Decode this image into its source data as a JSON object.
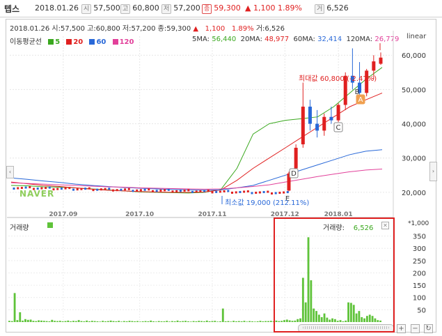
{
  "header": {
    "stock_name": "텝스",
    "date": "2018.01.26",
    "open_label": "시",
    "open": "57,500",
    "high_label": "고",
    "high": "60,800",
    "low_label": "저",
    "low": "57,200",
    "close_label": "종",
    "close": "59,300",
    "change_arrow": "▲",
    "change": "1,100",
    "change_pct": "1.89%",
    "volume_label": "거",
    "volume": "6,526"
  },
  "chart_info": {
    "line": "2018.01.26 시:57,500 고:60,800 저:57,200 종:59,300",
    "change_arrow": "▲",
    "change": "1,100",
    "change_pct": "1.89%",
    "volume": "거:6,526"
  },
  "ma_legend": {
    "title": "이동평균선",
    "items": [
      {
        "label": "5",
        "color": "#3aa81e"
      },
      {
        "label": "20",
        "color": "#e02020"
      },
      {
        "label": "60",
        "color": "#2868d8"
      },
      {
        "label": "120",
        "color": "#e2409a"
      }
    ]
  },
  "ma_values": {
    "ma5_label": "5MA:",
    "ma5": "56,440",
    "ma20_label": "20MA:",
    "ma20": "48,977",
    "ma60_label": "60MA:",
    "ma60": "32,414",
    "ma120_label": "120MA:",
    "ma120": "26,779"
  },
  "scale_mode": "linear",
  "watermark": "NAVER",
  "annotations": {
    "max": "최대값 60,800 (-2.47%)",
    "min": "최소값 19,000 (212.11%)",
    "markers": [
      "A",
      "B",
      "C",
      "D",
      "E"
    ]
  },
  "volume_panel": {
    "title": "거래량",
    "legend_label": "거래량:",
    "legend_value": "6,526",
    "unit": "*1,000",
    "close": "✕"
  },
  "colors": {
    "up": "#e02020",
    "down": "#2868d8",
    "volume": "#5fc33a",
    "highlight": "#e02020"
  },
  "controls": {
    "zoom_in": "+",
    "zoom_out": "−",
    "reset": "↻",
    "left": "‹",
    "right": "›"
  },
  "chart_data": [
    {
      "type": "line",
      "title": "",
      "x_ticks": [
        "2017.09",
        "2017.10",
        "2017.11",
        "2017.12",
        "2018.01"
      ],
      "y_ticks": [
        20000,
        30000,
        40000,
        50000,
        60000
      ],
      "ylim": [
        15500,
        63500
      ],
      "grid": true,
      "series": [
        {
          "name": "5",
          "color": "#3aa81e",
          "values": [
            22000,
            21900,
            21600,
            21500,
            21300,
            21000,
            20700,
            20400,
            20100,
            20000,
            19900,
            19800,
            20000,
            20800,
            27000,
            37000,
            40000,
            41000,
            41500,
            42000,
            45000,
            49000,
            53000,
            56440
          ]
        },
        {
          "name": "20",
          "color": "#e02020",
          "values": [
            23000,
            22500,
            22000,
            21700,
            21300,
            20900,
            20600,
            20400,
            20200,
            20100,
            20000,
            20000,
            20100,
            20700,
            23500,
            27000,
            30000,
            33000,
            36000,
            39000,
            42000,
            45000,
            47000,
            48977
          ]
        },
        {
          "name": "60",
          "color": "#2868d8",
          "values": [
            24200,
            23800,
            23300,
            22900,
            22400,
            22000,
            21700,
            21400,
            21200,
            21000,
            20800,
            20700,
            20600,
            20700,
            21300,
            22000,
            23500,
            25000,
            26500,
            28000,
            29500,
            31000,
            32000,
            32414
          ]
        },
        {
          "name": "120",
          "color": "#e2409a",
          "values": [
            22800,
            22600,
            22400,
            22200,
            22000,
            21800,
            21600,
            21500,
            21300,
            21200,
            21100,
            21000,
            20900,
            21000,
            21300,
            21700,
            22200,
            23000,
            23800,
            24600,
            25300,
            26000,
            26500,
            26779
          ]
        }
      ],
      "candles_recent": [
        {
          "open": 20500,
          "high": 26000,
          "low": 20300,
          "close": 25500
        },
        {
          "open": 27000,
          "high": 34000,
          "low": 26000,
          "close": 33000
        },
        {
          "open": 34000,
          "high": 52000,
          "low": 33000,
          "close": 45000
        },
        {
          "open": 45000,
          "high": 47000,
          "low": 38000,
          "close": 40000
        },
        {
          "open": 40000,
          "high": 44000,
          "low": 36000,
          "close": 38000
        },
        {
          "open": 38000,
          "high": 43000,
          "low": 36500,
          "close": 42000
        },
        {
          "open": 42000,
          "high": 45000,
          "low": 40000,
          "close": 41000
        },
        {
          "open": 41000,
          "high": 46000,
          "low": 40500,
          "close": 45500
        },
        {
          "open": 45500,
          "high": 55000,
          "low": 44000,
          "close": 54000
        },
        {
          "open": 54000,
          "high": 62000,
          "low": 50000,
          "close": 52000
        },
        {
          "open": 52000,
          "high": 58000,
          "low": 47000,
          "close": 49000
        },
        {
          "open": 49000,
          "high": 56000,
          "low": 48000,
          "close": 55500
        },
        {
          "open": 55500,
          "high": 60000,
          "low": 53000,
          "close": 58200
        },
        {
          "open": 57500,
          "high": 60800,
          "low": 57200,
          "close": 59300
        }
      ]
    },
    {
      "type": "bar",
      "title": "",
      "unit": "*1,000",
      "y_ticks": [
        50,
        100,
        150,
        200,
        250,
        300,
        350
      ],
      "ylim": [
        0,
        380
      ],
      "values": [
        5,
        4,
        118,
        8,
        40,
        6,
        12,
        9,
        10,
        5,
        4,
        7,
        6,
        5,
        4,
        3,
        9,
        5,
        4,
        5,
        3,
        4,
        6,
        3,
        5,
        4,
        8,
        4,
        3,
        6,
        3,
        5,
        4,
        3,
        2,
        5,
        3,
        4,
        6,
        4,
        3,
        5,
        2,
        4,
        3,
        5,
        4,
        3,
        4,
        2,
        3,
        4,
        3,
        6,
        3,
        2,
        4,
        3,
        3,
        5,
        2,
        4,
        3,
        6,
        3,
        4,
        5,
        3,
        2,
        4,
        3,
        5,
        4,
        3,
        6,
        3,
        4,
        5,
        2,
        3,
        55,
        3,
        4,
        2,
        5,
        3,
        4,
        3,
        5,
        2,
        4,
        3,
        2,
        3,
        5,
        3,
        4,
        4,
        5,
        3,
        6,
        4,
        5,
        8,
        10,
        7,
        5,
        6,
        12,
        15,
        180,
        80,
        345,
        170,
        55,
        45,
        30,
        20,
        35,
        18,
        10,
        15,
        12,
        5,
        8,
        3,
        6,
        80,
        78,
        70,
        35,
        45,
        20,
        15,
        25,
        30,
        25,
        15,
        8,
        6
      ]
    }
  ]
}
